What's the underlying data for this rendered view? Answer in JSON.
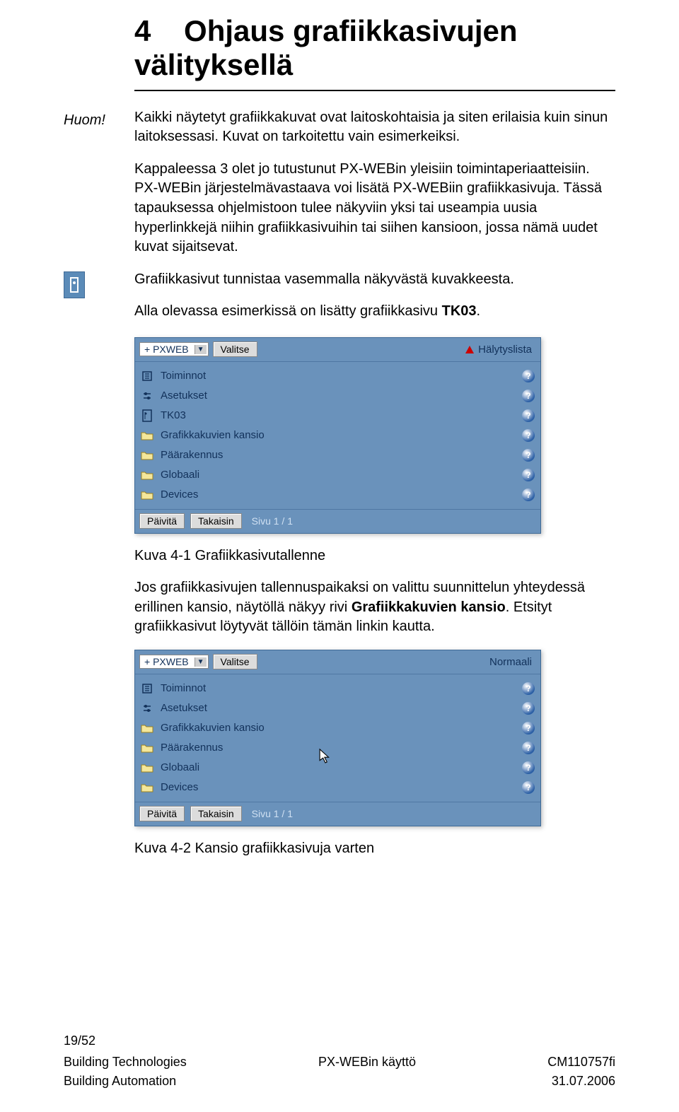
{
  "heading": {
    "num": "4",
    "title_line1": "Ohjaus grafiikkasivujen",
    "title_line2": "välityksellä"
  },
  "margin": {
    "huom": "Huom!"
  },
  "body": {
    "para1": "Kaikki näytetyt grafiikkakuvat ovat laitoskohtaisia ja siten erilaisia kuin sinun laitoksessasi. Kuvat on tarkoitettu vain esimerkeiksi.",
    "para2": "Kappaleessa 3 olet jo tutustunut PX-WEBin yleisiin toimintaperiaatteisiin. PX-WEBin järjestelmävastaava voi lisätä PX-WEBiin grafiikkasivuja. Tässä tapauksessa ohjelmistoon tulee näkyviin yksi tai useampia uusia hyperlinkkejä niihin grafiikkasivuihin tai siihen kansioon, jossa nämä uudet kuvat sijaitsevat.",
    "para3_a": "Grafiikkasivut tunnistaa vasemmalla näkyvästä kuvakkeesta.",
    "para3_b_prefix": "Alla olevassa esimerkissä on lisätty grafiikkasivu ",
    "para3_b_bold": "TK03",
    "para3_b_suffix": ".",
    "caption1": "Kuva 4-1 Grafiikkasivutallenne",
    "para4_prefix": "Jos grafiikkasivujen tallennuspaikaksi on valittu suunnittelun yhteydessä erillinen kansio, näytöllä näkyy rivi ",
    "para4_bold": "Grafiikkakuvien kansio",
    "para4_suffix": ". Etsityt grafiikkasivut löytyvät tällöin tämän linkin kautta.",
    "caption2": "Kuva 4-2 Kansio grafiikkasivuja varten"
  },
  "ui": {
    "select_label": "+ PXWEB",
    "valitse": "Valitse",
    "status1": "Hälytyslista",
    "status2": "Normaali",
    "paivita": "Päivitä",
    "takaisin": "Takaisin",
    "page_ind": "Sivu 1 / 1",
    "list1": [
      {
        "icon": "config",
        "label": "Toiminnot"
      },
      {
        "icon": "slider",
        "label": "Asetukset"
      },
      {
        "icon": "graphic",
        "label": "TK03"
      },
      {
        "icon": "folder",
        "label": "Grafikkakuvien kansio"
      },
      {
        "icon": "folder",
        "label": "Päärakennus"
      },
      {
        "icon": "folder",
        "label": "Globaali"
      },
      {
        "icon": "folder",
        "label": "Devices"
      }
    ],
    "list2": [
      {
        "icon": "config",
        "label": "Toiminnot"
      },
      {
        "icon": "slider",
        "label": "Asetukset"
      },
      {
        "icon": "folder",
        "label": "Grafikkakuvien kansio"
      },
      {
        "icon": "folder",
        "label": "Päärakennus"
      },
      {
        "icon": "folder",
        "label": "Globaali"
      },
      {
        "icon": "folder",
        "label": "Devices"
      }
    ]
  },
  "footer": {
    "page_num": "19/52",
    "l1_left": "Building Technologies",
    "l1_center": "PX-WEBin käyttö",
    "l1_right": "CM110757fi",
    "l2_left": "Building Automation",
    "l2_right": "31.07.2006"
  }
}
